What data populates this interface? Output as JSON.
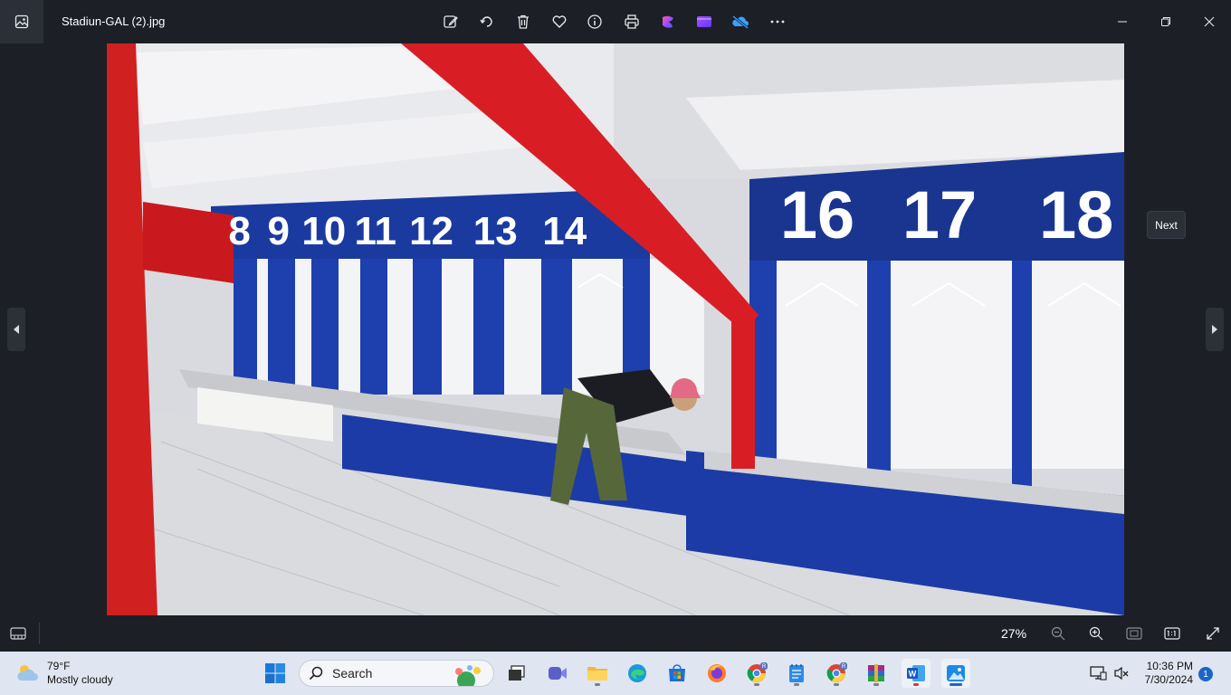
{
  "window": {
    "title": "Stadiun-GAL (2).jpg"
  },
  "toolbar": {
    "icons": [
      "edit-icon",
      "rotate-icon",
      "delete-icon",
      "favorite-icon",
      "info-icon",
      "print-icon",
      "clipchamp-icon",
      "video-editor-icon",
      "onedrive-icon",
      "more-icon"
    ]
  },
  "viewer": {
    "tooltip": "Next",
    "photo_numbers": [
      "8",
      "9",
      "10",
      "11",
      "12",
      "13",
      "14",
      "16",
      "17",
      "18"
    ]
  },
  "bottombar": {
    "zoom": "27%"
  },
  "taskbar": {
    "weather_temp": "79°F",
    "weather_desc": "Mostly cloudy",
    "search_label": "Search",
    "time": "10:36 PM",
    "date": "7/30/2024",
    "notification_count": "1"
  }
}
